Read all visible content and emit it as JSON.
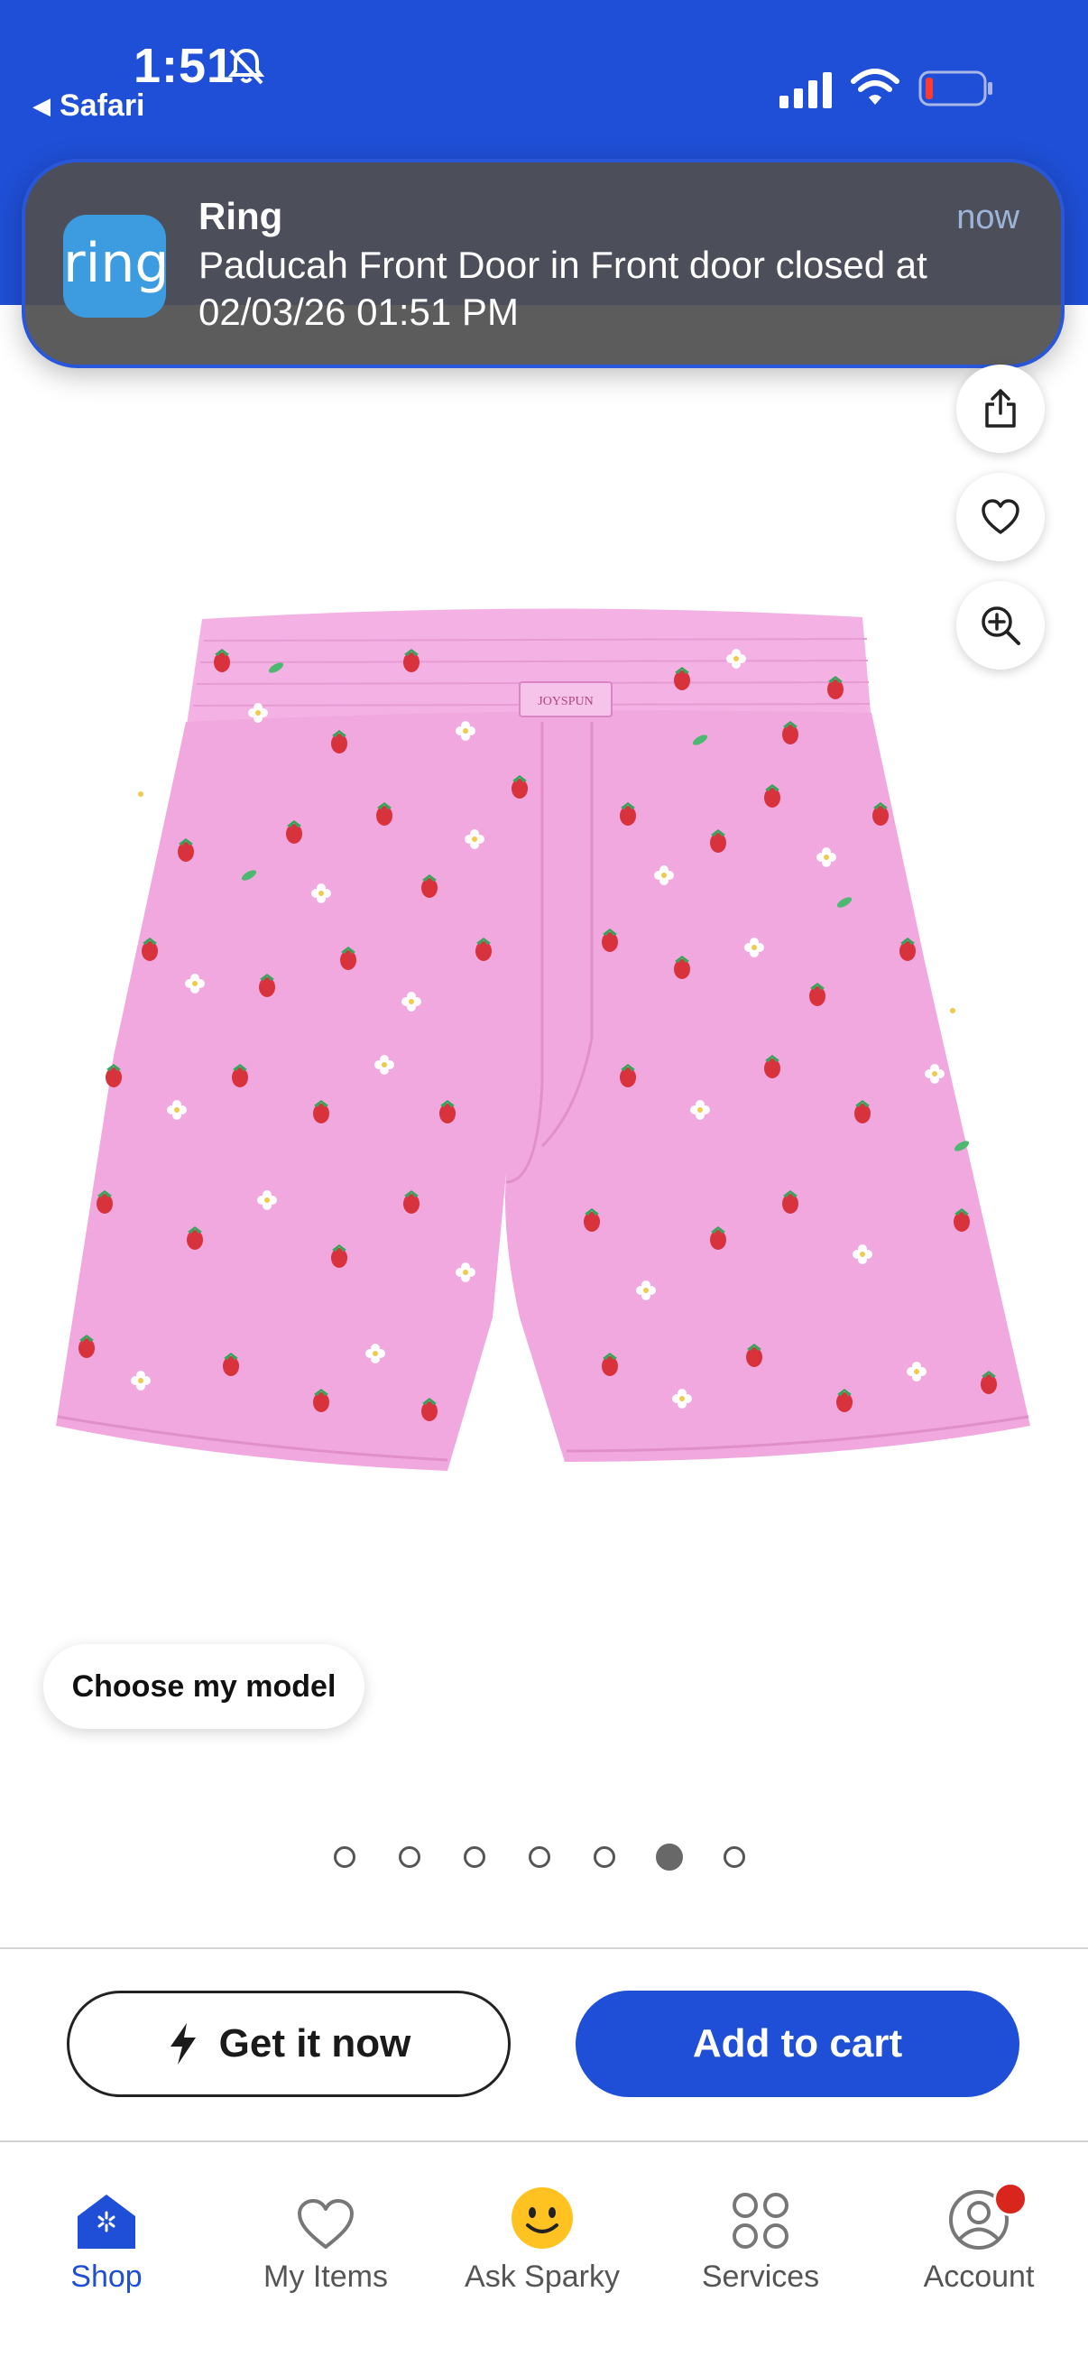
{
  "status": {
    "time": "1:51",
    "back_app": "Safari"
  },
  "notification": {
    "app": "Ring",
    "time": "now",
    "body": "Paducah Front Door in Front door closed at 02/03/26 01:51 PM",
    "icon_text": "ring"
  },
  "product": {
    "brand_tag": "JOYSPUN",
    "choose_model": "Choose my model",
    "image_count": 7,
    "active_image_index": 5
  },
  "actions": {
    "get_it_now": "Get it now",
    "add_to_cart": "Add to cart"
  },
  "tabbar": {
    "items": [
      {
        "label": "Shop",
        "icon": "shop-icon"
      },
      {
        "label": "My Items",
        "icon": "heart-icon"
      },
      {
        "label": "Ask Sparky",
        "icon": "sparky-icon"
      },
      {
        "label": "Services",
        "icon": "services-icon"
      },
      {
        "label": "Account",
        "icon": "account-icon"
      }
    ],
    "active": "Shop"
  },
  "colors": {
    "brand_blue": "#1f4fd6",
    "ring_blue": "#3d9be0",
    "shorts_pink": "#f0a6dc",
    "badge_red": "#d8261c"
  }
}
